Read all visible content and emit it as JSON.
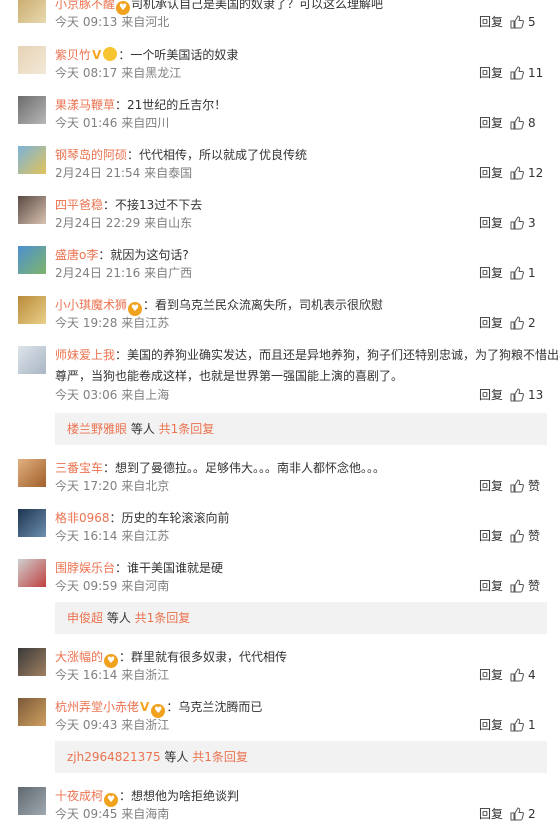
{
  "ui": {
    "reply": "回复",
    "more_replies": "条回复",
    "etc_people": "等人",
    "together": "共"
  },
  "comments": [
    {
      "user": "小京豚不醒",
      "text": "司机承认自己是美国的奴隶了？可以这么理解吧",
      "time": "今天 09:13 来自河北",
      "likes": "5",
      "avatar_colors": [
        "#c9a96a",
        "#e8d9b0"
      ]
    },
    {
      "user": "紫贝竹",
      "text": "：一个听美国话的奴隶",
      "time": "今天 08:17 来自黑龙江",
      "likes": "11",
      "avatar_colors": [
        "#e6d2b5",
        "#f3e9d8"
      ]
    },
    {
      "user": "果漾马鞭草",
      "text": "：21世纪的丘吉尔！",
      "time": "今天 01:46 来自四川",
      "likes": "8",
      "avatar_colors": [
        "#6c6c6c",
        "#b8b8b8"
      ]
    },
    {
      "user": "钢琴岛的阿硕",
      "text": "：代代相传，所以就成了优良传统",
      "time": "2月24日 21:54 来自泰国",
      "likes": "12",
      "avatar_colors": [
        "#7ab3d8",
        "#e3c35a"
      ]
    },
    {
      "user": "四平爸稳",
      "text": "：不接13过不下去",
      "time": "2月24日 22:29 来自山东",
      "likes": "3",
      "avatar_colors": [
        "#5a4a44",
        "#d9c2b0"
      ]
    },
    {
      "user": "盛唐o李",
      "text": "：就因为这句话?",
      "time": "2月24日 21:16 来自广西",
      "likes": "1",
      "avatar_colors": [
        "#4d8fd1",
        "#7fb56a"
      ]
    },
    {
      "user": "小小琪魔术狮",
      "text": "：看到乌克兰民众流离失所，司机表示很欣慰",
      "time": "今天 19:28 来自江苏",
      "likes": "2",
      "avatar_colors": [
        "#b98a3a",
        "#e9d08a"
      ]
    },
    {
      "user": "师妹爱上我",
      "text": "：美国的养狗业确实发达，而且还是异地养狗，狗子们还特别忠诚，为了狗粮不惜出卖",
      "text2": "尊严，当狗也能卷成这样，也就是世界第一强国能上演的喜剧了。",
      "time": "今天 03:06 来自上海",
      "likes": "13",
      "avatar_colors": [
        "#dde3ea",
        "#a9b6c4"
      ],
      "sub_reply_user": "楼兰野雅眼",
      "sub_reply_count": "1"
    },
    {
      "user": "三番宝车",
      "text": "：想到了曼德拉。。足够伟大。。。南非人都怀念他。。。",
      "time": "今天 17:20 来自北京",
      "likes": "赞",
      "avatar_colors": [
        "#e0b080",
        "#a0602a"
      ]
    },
    {
      "user": "格非0968",
      "text": "：历史的车轮滚滚向前",
      "time": "今天 16:14 来自江苏",
      "likes": "赞",
      "avatar_colors": [
        "#1d3550",
        "#6d8fb0"
      ]
    },
    {
      "user": "围脖娱乐台",
      "text": "：谁干美国谁就是硬",
      "time": "今天 09:59 来自河南",
      "likes": "赞",
      "avatar_colors": [
        "#d0d0d0",
        "#c04040"
      ],
      "sub_reply_user": "申俊超",
      "sub_reply_count": "1"
    },
    {
      "user": "大涨幅的",
      "text": "：群里就有很多奴隶，代代相传",
      "time": "今天 16:14 来自浙江",
      "likes": "4",
      "avatar_colors": [
        "#3a3a3a",
        "#a08060"
      ]
    },
    {
      "user": "杭州弄堂小赤佬",
      "text": "：乌克兰沈腾而已",
      "time": "今天 09:43 来自浙江",
      "likes": "1",
      "avatar_colors": [
        "#7a5a3a",
        "#d0a060"
      ],
      "sub_reply_user": "zjh2964821375",
      "sub_reply_count": "1"
    },
    {
      "user": "十夜成柯",
      "text": "：想想他为啥拒绝谈判",
      "time": "今天 09:45 来自海南",
      "likes": "2",
      "avatar_colors": [
        "#606870",
        "#a0a8b0"
      ]
    }
  ]
}
